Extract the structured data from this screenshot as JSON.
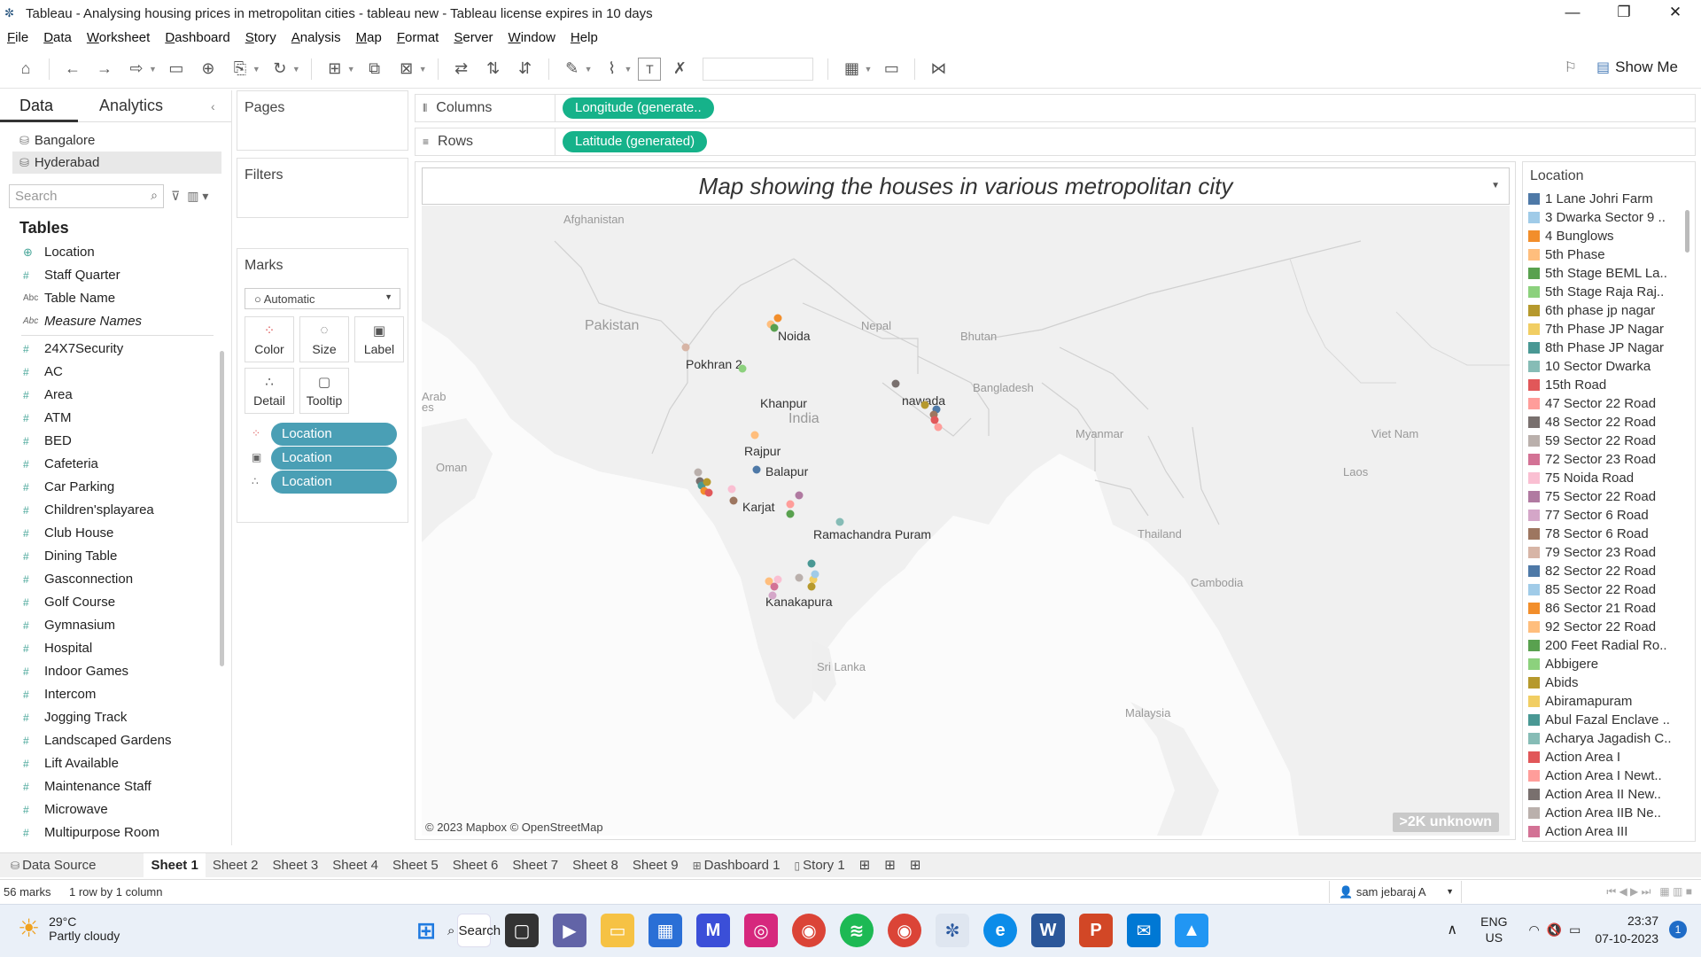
{
  "window": {
    "title": "Tableau - Analysing housing prices in metropolitan cities - tableau new - Tableau license expires in 10 days",
    "controls": [
      "—",
      "❐",
      "✕"
    ]
  },
  "menu": [
    "File",
    "Data",
    "Worksheet",
    "Dashboard",
    "Story",
    "Analysis",
    "Map",
    "Format",
    "Server",
    "Window",
    "Help"
  ],
  "toolbar": {
    "show_me": "Show Me"
  },
  "data_pane": {
    "tab_data": "Data",
    "tab_analytics": "Analytics",
    "sources": [
      "Bangalore",
      "Hyderabad"
    ],
    "search_placeholder": "Search",
    "tables_heading": "Tables",
    "dimension_fields": [
      {
        "type": "globe",
        "name": "Location"
      },
      {
        "type": "#",
        "name": "Staff Quarter"
      },
      {
        "type": "Abc",
        "name": "Table Name"
      },
      {
        "type": "Abc",
        "name": "Measure Names",
        "italic": true
      }
    ],
    "measure_fields": [
      "24X7Security",
      "AC",
      "Area",
      "ATM",
      "BED",
      "Cafeteria",
      "Car Parking",
      "Children'splayarea",
      "Club House",
      "Dining Table",
      "Gasconnection",
      "Golf Course",
      "Gymnasium",
      "Hospital",
      "Indoor Games",
      "Intercom",
      "Jogging Track",
      "Landscaped Gardens",
      "Lift Available",
      "Maintenance Staff",
      "Microwave",
      "Multipurpose Room"
    ]
  },
  "cards": {
    "pages": "Pages",
    "filters": "Filters",
    "marks": "Marks",
    "marks_type": "Automatic",
    "mark_buttons": [
      "Color",
      "Size",
      "Label",
      "Detail",
      "Tooltip"
    ],
    "mark_pills": [
      "Location",
      "Location",
      "Location"
    ]
  },
  "shelves": {
    "columns_label": "Columns",
    "columns_pill": "Longitude (generate..",
    "rows_label": "Rows",
    "rows_pill": "Latitude (generated)"
  },
  "view": {
    "title": "Map showing the houses in various metropolitan city",
    "attribution": "© 2023 Mapbox © OpenStreetMap",
    "unknown_badge": ">2K unknown",
    "map_labels": {
      "countries": [
        "Afghanistan",
        "Pakistan",
        "Nepal",
        "Bhutan",
        "Bangladesh",
        "India",
        "Myanmar",
        "Oman",
        "Viet Nam",
        "Laos",
        "Thailand",
        "Cambodia",
        "Sri Lanka",
        "Malaysia",
        "Arab",
        "es"
      ],
      "points": [
        "Noida",
        "Pokhran 2",
        "Khanpur",
        "nawada",
        "Rajpur",
        "Balapur",
        "Karjat",
        "Ramachandra Puram",
        "Kanakapura"
      ]
    }
  },
  "legend": {
    "title": "Location",
    "items": [
      {
        "label": "1 Lane Johri Farm",
        "color": "#4e79a7"
      },
      {
        "label": "3 Dwarka Sector 9 ..",
        "color": "#a0cbe8"
      },
      {
        "label": "4 Bunglows",
        "color": "#f28e2b"
      },
      {
        "label": "5th Phase",
        "color": "#ffbe7d"
      },
      {
        "label": "5th Stage BEML La..",
        "color": "#59a14f"
      },
      {
        "label": "5th Stage Raja Raj..",
        "color": "#8cd17d"
      },
      {
        "label": "6th phase jp nagar",
        "color": "#b6992d"
      },
      {
        "label": "7th Phase JP Nagar",
        "color": "#f1ce63"
      },
      {
        "label": "8th Phase JP Nagar",
        "color": "#499894"
      },
      {
        "label": "10 Sector Dwarka",
        "color": "#86bcb6"
      },
      {
        "label": "15th Road",
        "color": "#e15759"
      },
      {
        "label": "47 Sector 22 Road",
        "color": "#ff9d9a"
      },
      {
        "label": "48 Sector 22 Road",
        "color": "#79706e"
      },
      {
        "label": "59 Sector 22 Road",
        "color": "#bab0ac"
      },
      {
        "label": "72 Sector 23 Road",
        "color": "#d37295"
      },
      {
        "label": "75 Noida Road",
        "color": "#fabfd2"
      },
      {
        "label": "75 Sector 22 Road",
        "color": "#b07aa1"
      },
      {
        "label": "77 Sector 6 Road",
        "color": "#d4a6c8"
      },
      {
        "label": "78 Sector 6 Road",
        "color": "#9d7660"
      },
      {
        "label": "79 Sector 23 Road",
        "color": "#d7b5a6"
      },
      {
        "label": "82 Sector 22 Road",
        "color": "#4e79a7"
      },
      {
        "label": "85 Sector 22 Road",
        "color": "#a0cbe8"
      },
      {
        "label": "86 Sector 21 Road",
        "color": "#f28e2b"
      },
      {
        "label": "92 Sector 22 Road",
        "color": "#ffbe7d"
      },
      {
        "label": "200 Feet Radial Ro..",
        "color": "#59a14f"
      },
      {
        "label": "Abbigere",
        "color": "#8cd17d"
      },
      {
        "label": "Abids",
        "color": "#b6992d"
      },
      {
        "label": "Abiramapuram",
        "color": "#f1ce63"
      },
      {
        "label": "Abul Fazal Enclave ..",
        "color": "#499894"
      },
      {
        "label": "Acharya Jagadish C..",
        "color": "#86bcb6"
      },
      {
        "label": "Action Area I",
        "color": "#e15759"
      },
      {
        "label": "Action Area I Newt..",
        "color": "#ff9d9a"
      },
      {
        "label": "Action Area II New..",
        "color": "#79706e"
      },
      {
        "label": "Action Area IIB Ne..",
        "color": "#bab0ac"
      },
      {
        "label": "Action Area III",
        "color": "#d37295"
      }
    ]
  },
  "sheet_tabs": {
    "data_source": "Data Source",
    "sheets": [
      "Sheet 1",
      "Sheet 2",
      "Sheet 3",
      "Sheet 4",
      "Sheet 5",
      "Sheet 6",
      "Sheet 7",
      "Sheet 8",
      "Sheet 9"
    ],
    "active": "Sheet 1",
    "dashboard": "Dashboard 1",
    "story": "Story 1"
  },
  "status": {
    "marks": "56 marks",
    "dims": "1 row by 1 column",
    "user": "sam jebaraj A"
  },
  "taskbar": {
    "temp": "29°C",
    "weather": "Partly cloudy",
    "search": "Search",
    "lang1": "ENG",
    "lang2": "US",
    "time": "23:37",
    "date": "07-10-2023",
    "notifications": "1"
  }
}
